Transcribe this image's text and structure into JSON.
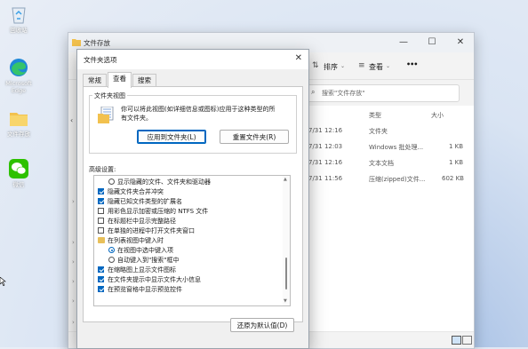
{
  "desktop": {
    "icons": [
      {
        "label": "回收站"
      },
      {
        "label": "Microsoft Edge"
      },
      {
        "label": "文件存放"
      },
      {
        "label": "微信"
      }
    ]
  },
  "explorer": {
    "title": "文件存放",
    "toolbar": {
      "sort_label": "排序",
      "view_label": "查看",
      "more_label": "•••"
    },
    "search_placeholder": "搜索\"文件存放\"",
    "columns": {
      "type": "类型",
      "size": "大小"
    },
    "rows": [
      {
        "date": "7/31 12:16",
        "type": "文件夹",
        "size": ""
      },
      {
        "date": "7/31 12:03",
        "type": "Windows 批处理...",
        "size": "1 KB"
      },
      {
        "date": "7/31 12:16",
        "type": "文本文档",
        "size": "1 KB"
      },
      {
        "date": "7/31 11:56",
        "type": "压缩(zipped)文件...",
        "size": "602 KB"
      }
    ]
  },
  "dialog": {
    "title": "文件夹选项",
    "tabs": [
      {
        "label": "常规",
        "active": false
      },
      {
        "label": "查看",
        "active": true
      },
      {
        "label": "搜索",
        "active": false
      }
    ],
    "folder_views": {
      "legend": "文件夹视图",
      "description_line1": "你可以将此视图(如详细信息或图标)应用于这种类型的所",
      "description_line2": "有文件夹。",
      "apply_button": "应用到文件夹(L)",
      "reset_button": "重置文件夹(R)"
    },
    "advanced_label": "高级设置:",
    "options": [
      {
        "kind": "radio",
        "checked": false,
        "label": "显示隐藏的文件、文件夹和驱动器"
      },
      {
        "kind": "checkbox",
        "checked": true,
        "label": "隐藏文件夹合并冲突"
      },
      {
        "kind": "checkbox",
        "checked": true,
        "label": "隐藏已知文件类型的扩展名"
      },
      {
        "kind": "checkbox",
        "checked": false,
        "label": "用彩色显示加密或压缩的 NTFS 文件"
      },
      {
        "kind": "checkbox",
        "checked": false,
        "label": "在标题栏中显示完整路径"
      },
      {
        "kind": "checkbox",
        "checked": false,
        "label": "在单独的进程中打开文件夹窗口"
      },
      {
        "kind": "folder",
        "checked": false,
        "label": "在列表视图中键入时"
      },
      {
        "kind": "radio",
        "checked": true,
        "label": "在视图中选中键入项"
      },
      {
        "kind": "radio",
        "checked": false,
        "label": "自动键入到\"搜索\"框中"
      },
      {
        "kind": "checkbox",
        "checked": true,
        "label": "在缩略图上显示文件图标"
      },
      {
        "kind": "checkbox",
        "checked": true,
        "label": "在文件夹提示中显示文件大小信息"
      },
      {
        "kind": "checkbox",
        "checked": true,
        "label": "在预览窗格中显示预览控件"
      }
    ],
    "restore_button": "还原为默认值(D)"
  }
}
